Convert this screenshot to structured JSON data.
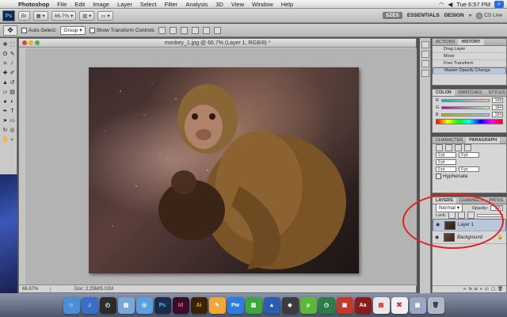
{
  "menubar": {
    "app": "Photoshop",
    "items": [
      "File",
      "Edit",
      "Image",
      "Layer",
      "Select",
      "Filter",
      "Analysis",
      "3D",
      "View",
      "Window",
      "Help"
    ],
    "clock": "Tue 6:57 PM"
  },
  "appbar": {
    "logo": "Ps",
    "zoom": "66.7",
    "workspaces": [
      "ESSENTIALS",
      "DESIGN"
    ],
    "active_workspace": "SZES",
    "cs_live": "CS Live"
  },
  "options": {
    "auto_select_label": "Auto-Select:",
    "auto_select_value": "Group",
    "show_transform_label": "Show Transform Controls"
  },
  "document": {
    "title": "monkey_1.jpg @ 66.7% (Layer 1, RGB/8) *",
    "status_zoom": "66.67%",
    "status_doc": "Doc: 2.25M/5.01M"
  },
  "panels": {
    "history": {
      "tabs": [
        "ACTIONS",
        "HISTORY"
      ],
      "items": [
        "Drag Layer",
        "Move",
        "Free Transform",
        "Master Opacity Change"
      ]
    },
    "color": {
      "tabs": [
        "COLOR",
        "SWATCHES",
        "STYLES"
      ],
      "channels": [
        {
          "label": "R",
          "value": "168"
        },
        {
          "label": "G",
          "value": "184"
        },
        {
          "label": "B",
          "value": "184"
        }
      ]
    },
    "character": {
      "tabs": [
        "CHARACTER",
        "PARAGRAPH"
      ],
      "fields": [
        "0 pt",
        "0 pt",
        "0 pt",
        "0 pt",
        "0 pt"
      ],
      "hyphenate_label": "Hyphenate"
    },
    "layers": {
      "tabs": [
        "LAYERS",
        "CHANNELS",
        "PATHS"
      ],
      "blend_mode": "Normal",
      "opacity_label": "Opacity:",
      "opacity_value": "100",
      "lock_label": "Lock:",
      "items": [
        {
          "name": "Layer 1"
        },
        {
          "name": "Background"
        }
      ]
    }
  },
  "dock": {
    "apps": [
      "Finder",
      "iTunes",
      "Dashboard",
      "Preview",
      "iChat",
      "Ps",
      "Id",
      "Ai",
      "Pages",
      "Pw",
      "Numbers",
      "Keynote",
      "Bridge",
      "uTorrent",
      "Time Machine",
      "Photo Booth",
      "Dictionary",
      "PDF",
      "Acrobat",
      "Documents",
      "Trash"
    ]
  },
  "colors": {
    "annotation": "#e22222",
    "selection": "#b8c7dd"
  }
}
